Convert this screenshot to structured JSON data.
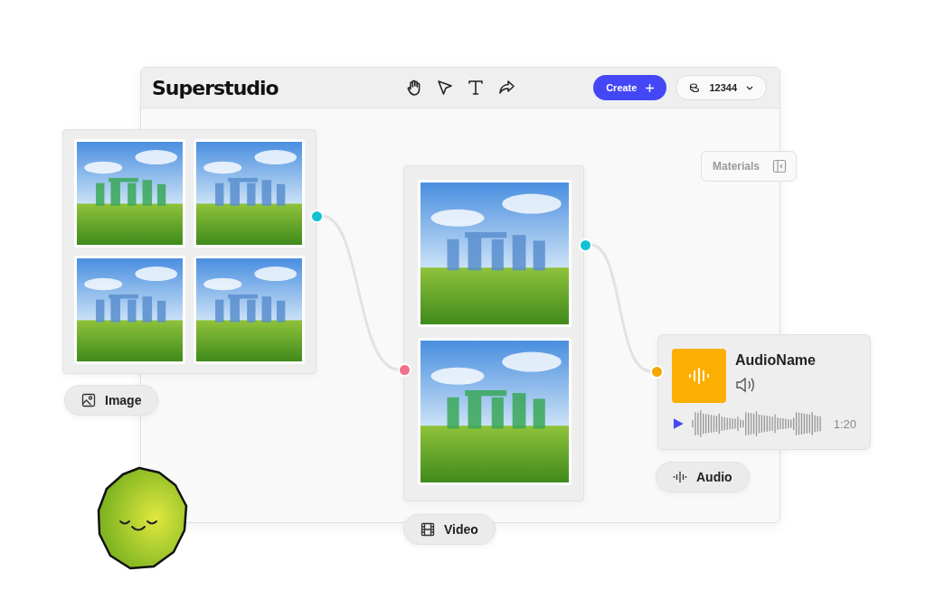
{
  "header": {
    "logo": "Superstudio",
    "create_button": "Create",
    "credits": "12344"
  },
  "materials_button": "Materials",
  "image_node": {
    "photos": [
      {
        "kind": "green"
      },
      {
        "kind": "blue"
      },
      {
        "kind": "blue"
      },
      {
        "kind": "blue"
      }
    ],
    "label": "Image"
  },
  "video_node": {
    "frames": [
      {
        "kind": "blue"
      },
      {
        "kind": "green"
      }
    ],
    "label": "Video"
  },
  "audio_node": {
    "name": "AudioName",
    "duration": "1:20",
    "label": "Audio"
  },
  "ports": [
    {
      "color": "#12c2d4"
    },
    {
      "color": "#f2708a"
    },
    {
      "color": "#12c2d4"
    },
    {
      "color": "#f5a800"
    }
  ]
}
